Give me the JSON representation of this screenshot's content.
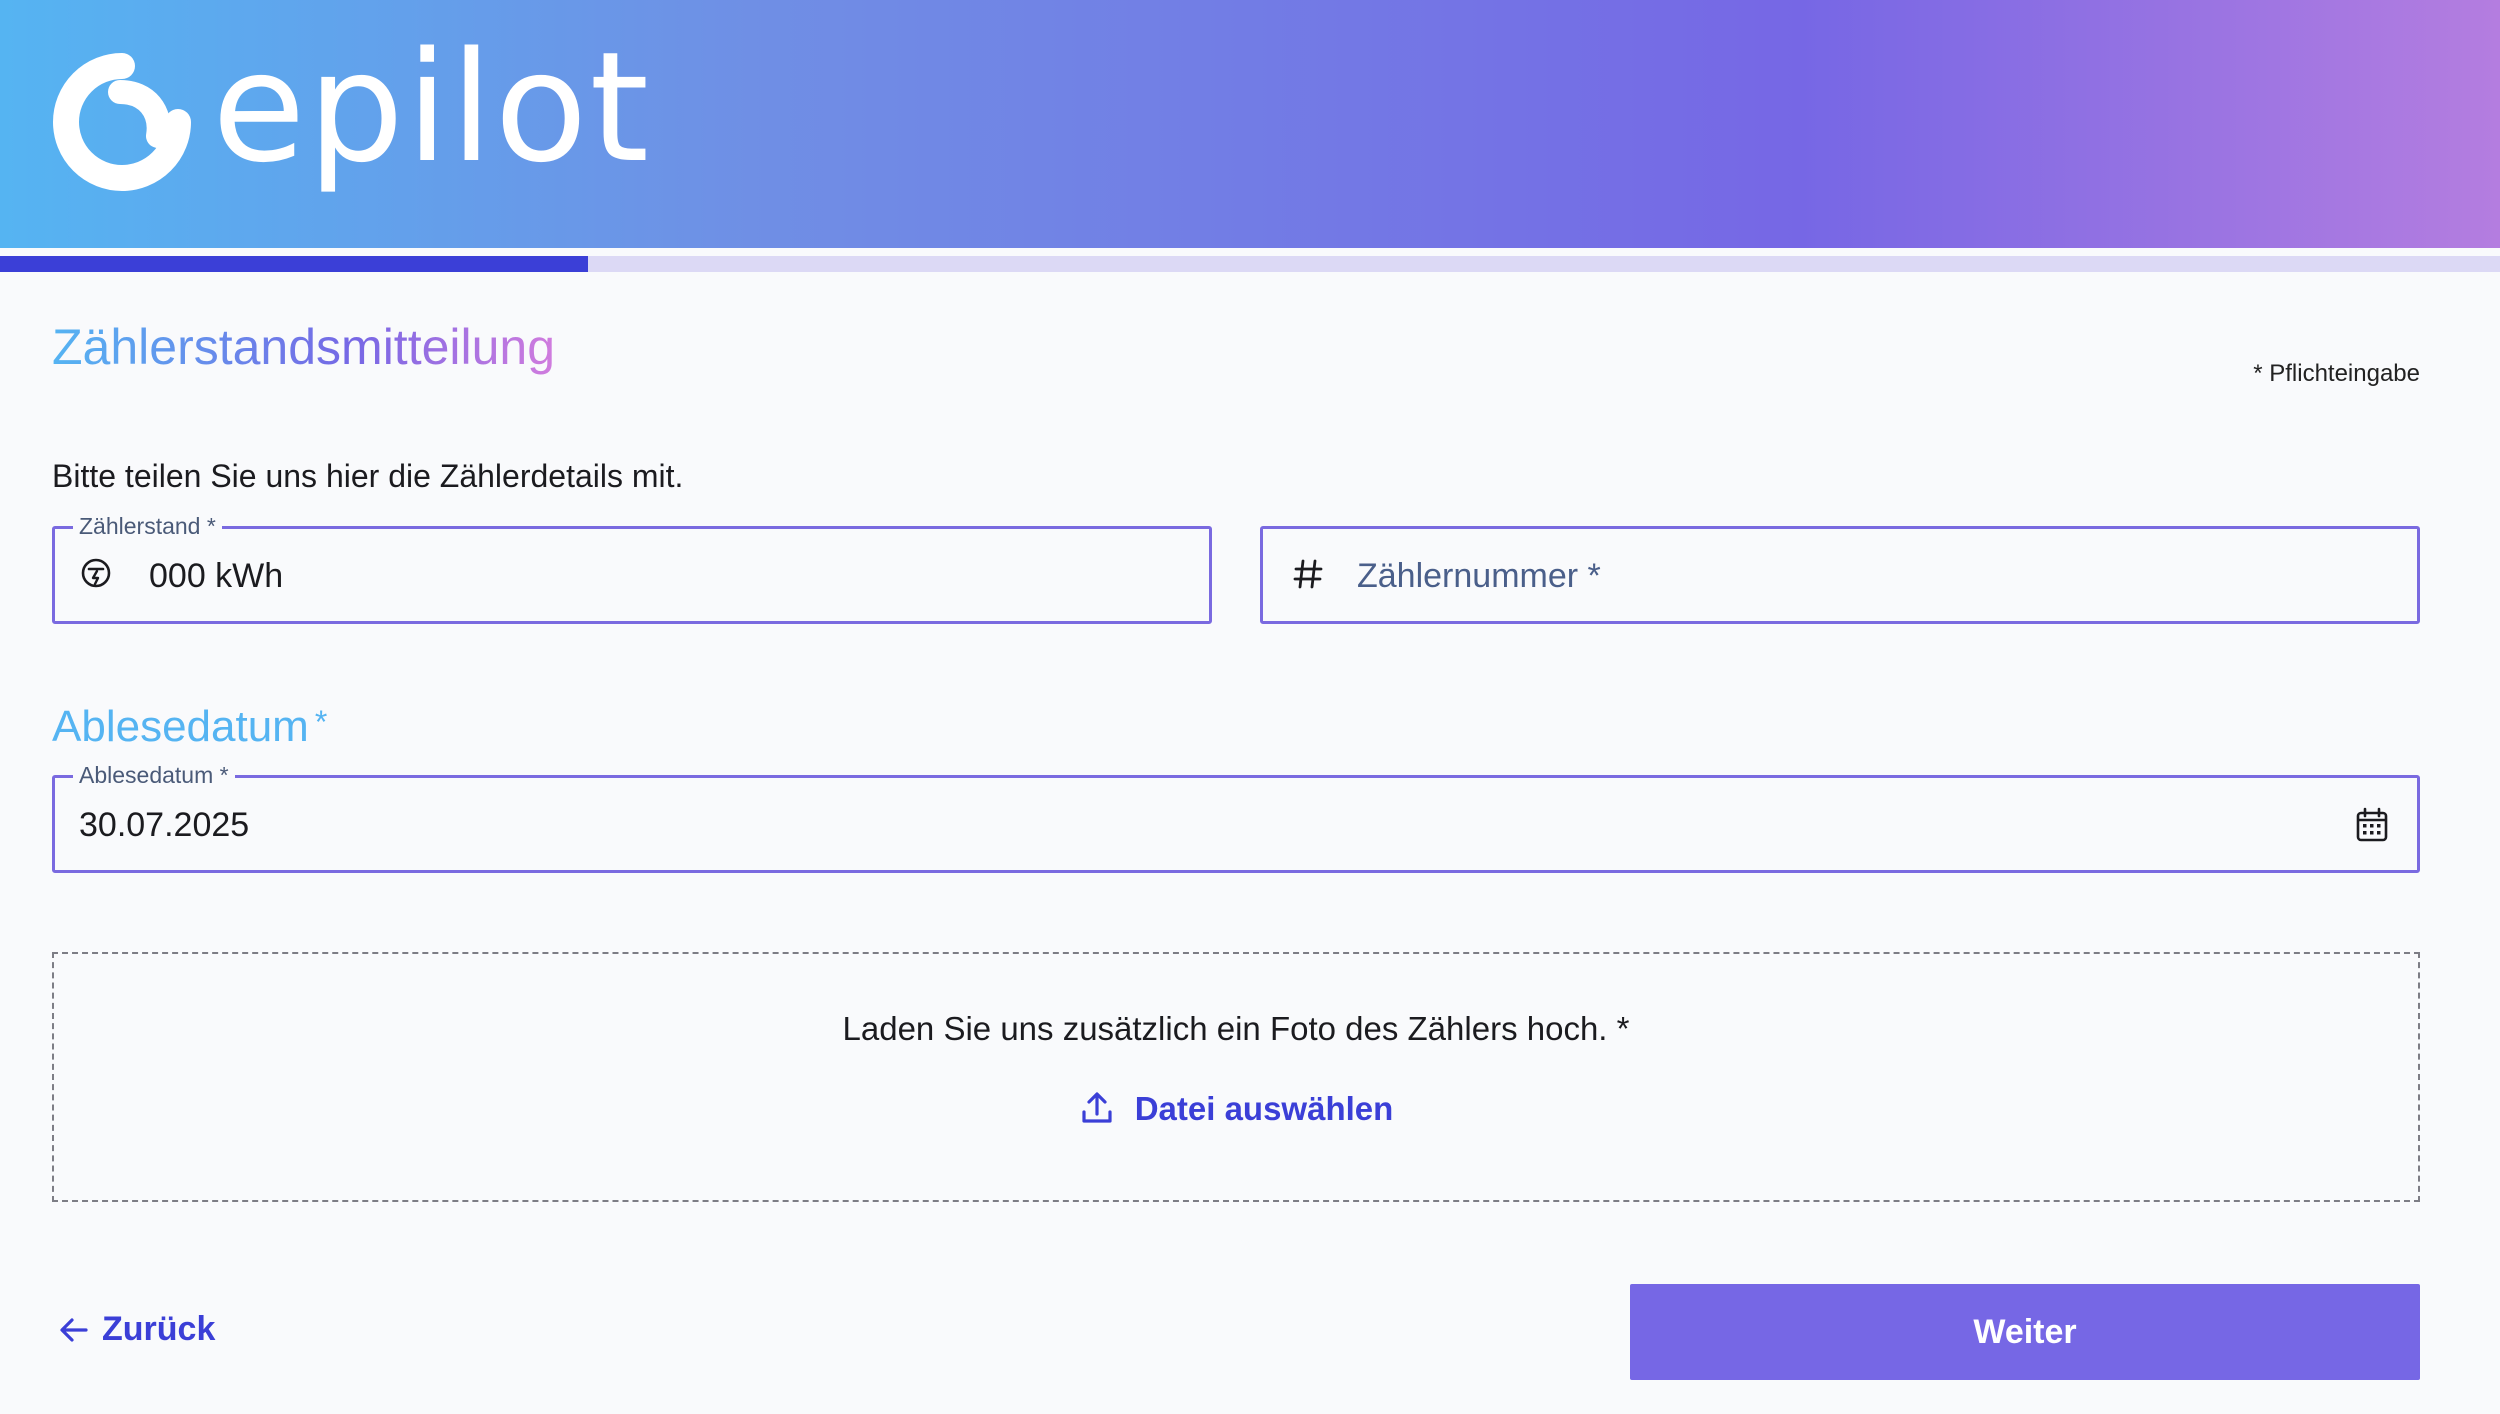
{
  "header": {
    "logo_text": "epilot",
    "gradient": [
      "#55b4f2",
      "#7667e5",
      "#b47de0"
    ]
  },
  "progress": {
    "fraction": 0.235
  },
  "form": {
    "title": "Zählerstandsmitteilung",
    "required_note": "* Pflichteingabe",
    "intro": "Bitte teilen Sie uns hier die Zählerdetails mit.",
    "meter_reading": {
      "label": "Zählerstand *",
      "value": "000 kWh",
      "icon": "meter-gauge-icon"
    },
    "meter_number": {
      "placeholder": "Zählernummer *",
      "icon": "hash-icon"
    },
    "reading_date_section": {
      "title": "Ablesedatum",
      "required_mark": "*"
    },
    "reading_date": {
      "label": "Ablesedatum *",
      "value": "30.07.2025",
      "icon": "calendar-icon"
    },
    "upload": {
      "text": "Laden Sie uns zusätzlich ein Foto des Zählers hoch. *",
      "button_label": "Datei auswählen",
      "icon": "upload-icon"
    }
  },
  "footer": {
    "back_label": "Zurück",
    "next_label": "Weiter"
  },
  "colors": {
    "accent": "#3b3fd7",
    "primary_button": "#7667e5",
    "field_border": "#7a6ae0"
  }
}
